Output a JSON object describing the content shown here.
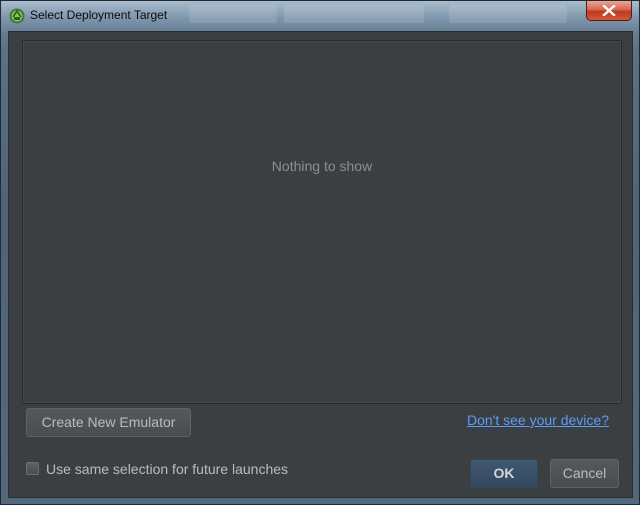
{
  "window": {
    "title": "Select Deployment Target",
    "icon": "android-studio-icon",
    "close_icon": "close-icon"
  },
  "device_list": {
    "empty_text": "Nothing to show"
  },
  "actions": {
    "create_emulator_label": "Create New Emulator",
    "device_help_link": "Don't see your device?"
  },
  "options": {
    "same_selection_label": "Use same selection for future launches",
    "same_selection_checked": false
  },
  "buttons": {
    "ok_label": "OK",
    "cancel_label": "Cancel"
  },
  "colors": {
    "dialog_background": "#3c3f41",
    "link": "#589df6",
    "close_button": "#c0391f",
    "default_button": "#34495e"
  }
}
